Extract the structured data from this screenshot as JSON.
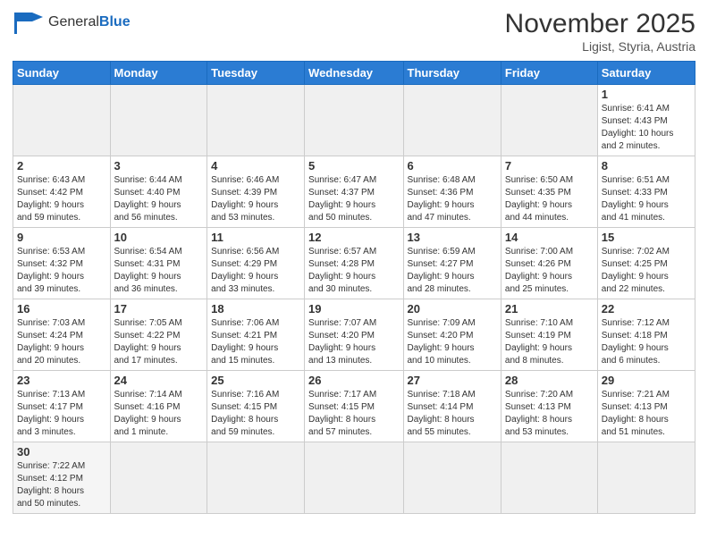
{
  "header": {
    "logo_general": "General",
    "logo_blue": "Blue",
    "month_title": "November 2025",
    "location": "Ligist, Styria, Austria"
  },
  "days_of_week": [
    "Sunday",
    "Monday",
    "Tuesday",
    "Wednesday",
    "Thursday",
    "Friday",
    "Saturday"
  ],
  "weeks": [
    [
      {
        "day": "",
        "info": ""
      },
      {
        "day": "",
        "info": ""
      },
      {
        "day": "",
        "info": ""
      },
      {
        "day": "",
        "info": ""
      },
      {
        "day": "",
        "info": ""
      },
      {
        "day": "",
        "info": ""
      },
      {
        "day": "1",
        "info": "Sunrise: 6:41 AM\nSunset: 4:43 PM\nDaylight: 10 hours\nand 2 minutes."
      }
    ],
    [
      {
        "day": "2",
        "info": "Sunrise: 6:43 AM\nSunset: 4:42 PM\nDaylight: 9 hours\nand 59 minutes."
      },
      {
        "day": "3",
        "info": "Sunrise: 6:44 AM\nSunset: 4:40 PM\nDaylight: 9 hours\nand 56 minutes."
      },
      {
        "day": "4",
        "info": "Sunrise: 6:46 AM\nSunset: 4:39 PM\nDaylight: 9 hours\nand 53 minutes."
      },
      {
        "day": "5",
        "info": "Sunrise: 6:47 AM\nSunset: 4:37 PM\nDaylight: 9 hours\nand 50 minutes."
      },
      {
        "day": "6",
        "info": "Sunrise: 6:48 AM\nSunset: 4:36 PM\nDaylight: 9 hours\nand 47 minutes."
      },
      {
        "day": "7",
        "info": "Sunrise: 6:50 AM\nSunset: 4:35 PM\nDaylight: 9 hours\nand 44 minutes."
      },
      {
        "day": "8",
        "info": "Sunrise: 6:51 AM\nSunset: 4:33 PM\nDaylight: 9 hours\nand 41 minutes."
      }
    ],
    [
      {
        "day": "9",
        "info": "Sunrise: 6:53 AM\nSunset: 4:32 PM\nDaylight: 9 hours\nand 39 minutes."
      },
      {
        "day": "10",
        "info": "Sunrise: 6:54 AM\nSunset: 4:31 PM\nDaylight: 9 hours\nand 36 minutes."
      },
      {
        "day": "11",
        "info": "Sunrise: 6:56 AM\nSunset: 4:29 PM\nDaylight: 9 hours\nand 33 minutes."
      },
      {
        "day": "12",
        "info": "Sunrise: 6:57 AM\nSunset: 4:28 PM\nDaylight: 9 hours\nand 30 minutes."
      },
      {
        "day": "13",
        "info": "Sunrise: 6:59 AM\nSunset: 4:27 PM\nDaylight: 9 hours\nand 28 minutes."
      },
      {
        "day": "14",
        "info": "Sunrise: 7:00 AM\nSunset: 4:26 PM\nDaylight: 9 hours\nand 25 minutes."
      },
      {
        "day": "15",
        "info": "Sunrise: 7:02 AM\nSunset: 4:25 PM\nDaylight: 9 hours\nand 22 minutes."
      }
    ],
    [
      {
        "day": "16",
        "info": "Sunrise: 7:03 AM\nSunset: 4:24 PM\nDaylight: 9 hours\nand 20 minutes."
      },
      {
        "day": "17",
        "info": "Sunrise: 7:05 AM\nSunset: 4:22 PM\nDaylight: 9 hours\nand 17 minutes."
      },
      {
        "day": "18",
        "info": "Sunrise: 7:06 AM\nSunset: 4:21 PM\nDaylight: 9 hours\nand 15 minutes."
      },
      {
        "day": "19",
        "info": "Sunrise: 7:07 AM\nSunset: 4:20 PM\nDaylight: 9 hours\nand 13 minutes."
      },
      {
        "day": "20",
        "info": "Sunrise: 7:09 AM\nSunset: 4:20 PM\nDaylight: 9 hours\nand 10 minutes."
      },
      {
        "day": "21",
        "info": "Sunrise: 7:10 AM\nSunset: 4:19 PM\nDaylight: 9 hours\nand 8 minutes."
      },
      {
        "day": "22",
        "info": "Sunrise: 7:12 AM\nSunset: 4:18 PM\nDaylight: 9 hours\nand 6 minutes."
      }
    ],
    [
      {
        "day": "23",
        "info": "Sunrise: 7:13 AM\nSunset: 4:17 PM\nDaylight: 9 hours\nand 3 minutes."
      },
      {
        "day": "24",
        "info": "Sunrise: 7:14 AM\nSunset: 4:16 PM\nDaylight: 9 hours\nand 1 minute."
      },
      {
        "day": "25",
        "info": "Sunrise: 7:16 AM\nSunset: 4:15 PM\nDaylight: 8 hours\nand 59 minutes."
      },
      {
        "day": "26",
        "info": "Sunrise: 7:17 AM\nSunset: 4:15 PM\nDaylight: 8 hours\nand 57 minutes."
      },
      {
        "day": "27",
        "info": "Sunrise: 7:18 AM\nSunset: 4:14 PM\nDaylight: 8 hours\nand 55 minutes."
      },
      {
        "day": "28",
        "info": "Sunrise: 7:20 AM\nSunset: 4:13 PM\nDaylight: 8 hours\nand 53 minutes."
      },
      {
        "day": "29",
        "info": "Sunrise: 7:21 AM\nSunset: 4:13 PM\nDaylight: 8 hours\nand 51 minutes."
      }
    ],
    [
      {
        "day": "30",
        "info": "Sunrise: 7:22 AM\nSunset: 4:12 PM\nDaylight: 8 hours\nand 50 minutes."
      },
      {
        "day": "",
        "info": ""
      },
      {
        "day": "",
        "info": ""
      },
      {
        "day": "",
        "info": ""
      },
      {
        "day": "",
        "info": ""
      },
      {
        "day": "",
        "info": ""
      },
      {
        "day": "",
        "info": ""
      }
    ]
  ]
}
